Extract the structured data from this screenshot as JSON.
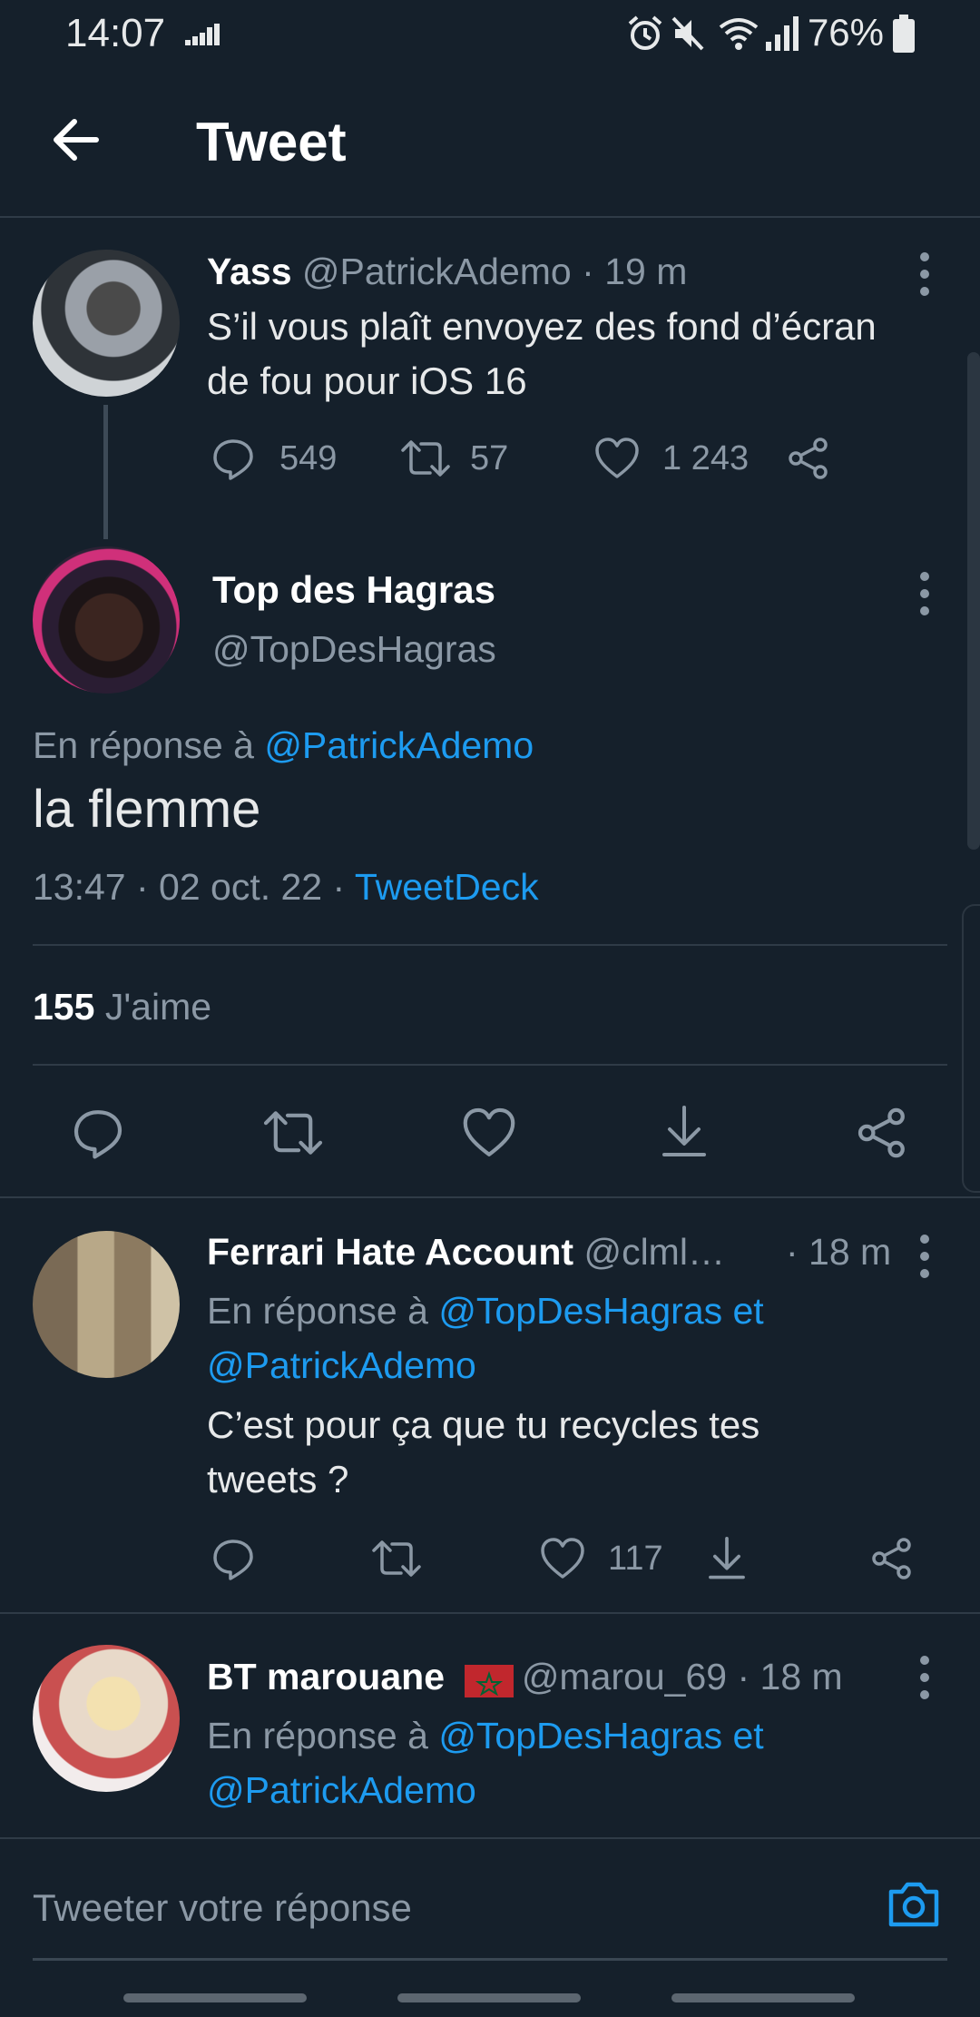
{
  "status_bar": {
    "time": "14:07",
    "battery": "76%"
  },
  "header": {
    "title": "Tweet"
  },
  "parent_tweet": {
    "name": "Yass",
    "handle": "@PatrickAdemo",
    "time": "· 19 m",
    "text_line1": "S’il vous plaît envoyez des fond d’écran",
    "text_line2": "de fou pour iOS 16",
    "replies": "549",
    "retweets": "57",
    "likes": "1 243"
  },
  "main_tweet": {
    "name": "Top des Hagras",
    "handle": "@TopDesHagras",
    "reply_prefix": "En réponse à",
    "reply_to": "@PatrickAdemo",
    "text": "la flemme",
    "timestamp": "13:47 · 02 oct. 22 ·",
    "source": "TweetDeck",
    "likes_count": "155",
    "likes_label": "J'aime"
  },
  "replies": [
    {
      "name": "Ferrari Hate Account",
      "handle": "@clml…",
      "time": "· 18 m",
      "reply_prefix": "En réponse à",
      "reply_to_line1": "@TopDesHagras et",
      "reply_to_line2": "@PatrickAdemo",
      "text_line1": "C’est pour ça que tu recycles tes",
      "text_line2": "tweets ?",
      "likes": "117"
    },
    {
      "name": "BT marouane",
      "handle": "@marou_69",
      "time": "· 18 m",
      "reply_prefix": "En réponse à",
      "reply_to_line1": "@TopDesHagras et",
      "reply_to_line2": "@PatrickAdemo"
    }
  ],
  "reply_bar": {
    "placeholder": "Tweeter votre réponse"
  },
  "colors": {
    "background": "#15202b",
    "accent": "#1d9bf0",
    "muted": "#8b98a5"
  }
}
